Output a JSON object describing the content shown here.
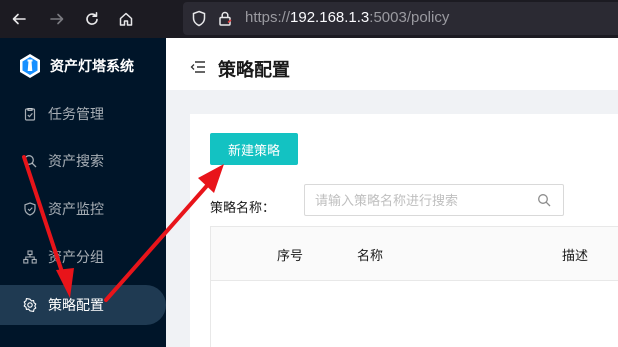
{
  "browser": {
    "url_scheme": "https://",
    "url_host": "192.168.1.3",
    "url_rest": ":5003/policy"
  },
  "sidebar": {
    "app_name": "资产灯塔系统",
    "items": [
      {
        "label": "任务管理",
        "icon": "clipboard-icon",
        "active": false
      },
      {
        "label": "资产搜索",
        "icon": "search-icon",
        "active": false
      },
      {
        "label": "资产监控",
        "icon": "shield-icon",
        "active": false
      },
      {
        "label": "资产分组",
        "icon": "cluster-icon",
        "active": false
      },
      {
        "label": "策略配置",
        "icon": "gear-icon",
        "active": true
      }
    ]
  },
  "header": {
    "title": "策略配置"
  },
  "main": {
    "new_button": "新建策略",
    "search_label": "策略名称：",
    "search_placeholder": "请输入策略名称进行搜索",
    "search_value": "",
    "table_columns": [
      "序号",
      "名称",
      "描述"
    ]
  },
  "colors": {
    "sidebar_bg": "#001529",
    "accent": "#13c2c2",
    "annotation_arrow": "#e8141a"
  }
}
